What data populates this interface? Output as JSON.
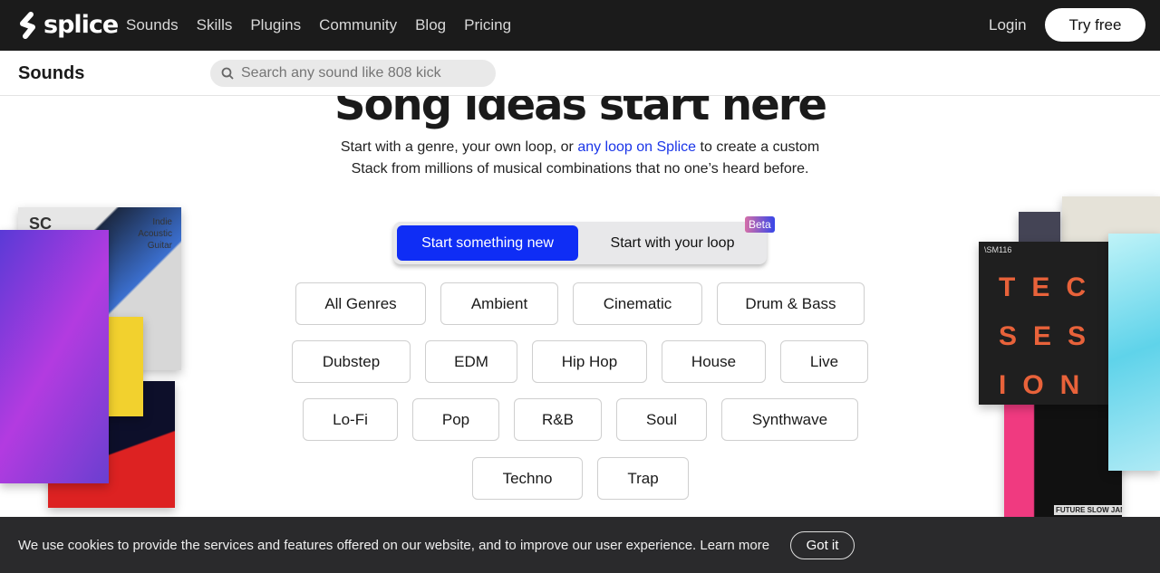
{
  "nav": {
    "brand": "splice",
    "links": [
      "Sounds",
      "Skills",
      "Plugins",
      "Community",
      "Blog",
      "Pricing"
    ],
    "login": "Login",
    "try_free": "Try free"
  },
  "subbar": {
    "title": "Sounds",
    "search_placeholder": "Search any sound like 808 kick"
  },
  "hero": {
    "headline": "Song ideas start here",
    "line1_pre": "Start with a genre, your own loop, or ",
    "line1_link": "any loop on Splice",
    "line1_post": " to create a custom",
    "line2": "Stack from millions of musical combinations that no one’s heard before."
  },
  "toggle": {
    "active": "Start something new",
    "inactive": "Start with your loop",
    "badge": "Beta"
  },
  "genres": [
    "All Genres",
    "Ambient",
    "Cinematic",
    "Drum & Bass",
    "Dubstep",
    "EDM",
    "Hip Hop",
    "House",
    "Live",
    "Lo-Fi",
    "Pop",
    "R&B",
    "Soul",
    "Synthwave",
    "Techno",
    "Trap"
  ],
  "art": {
    "left_card_logo": "SC",
    "left_card_text": "Indie Acoustic Guitar",
    "right_card_logo": "\\SM116",
    "right_card_letters": "TEC SES ION",
    "right_bottom_text": "FUTURE SLOW JAMS"
  },
  "cookie": {
    "text": "We use cookies to provide the services and features offered on our website, and to improve our user experience. ",
    "link": "Learn more",
    "button": "Got it"
  },
  "colors": {
    "accent": "#0f2df5",
    "nav_bg": "#1b1b1b",
    "link": "#1a35e8"
  }
}
